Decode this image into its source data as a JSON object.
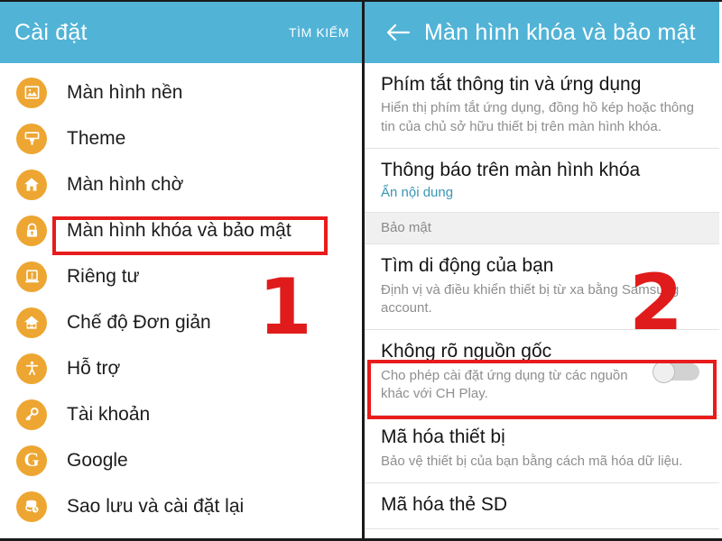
{
  "left_panel": {
    "header": {
      "title": "Cài đặt",
      "action_label": "TÌM KIẾM"
    },
    "items": [
      {
        "label": "Màn hình nền",
        "icon": "image-icon"
      },
      {
        "label": "Theme",
        "icon": "brush-icon"
      },
      {
        "label": "Màn hình chờ",
        "icon": "home-icon"
      },
      {
        "label": "Màn hình khóa và bảo mật",
        "icon": "lock-icon"
      },
      {
        "label": "Riêng tư",
        "icon": "privacy-icon"
      },
      {
        "label": "Chế độ Đơn giản",
        "icon": "simple-mode-icon"
      },
      {
        "label": "Hỗ trợ",
        "icon": "accessibility-icon"
      },
      {
        "label": "Tài khoản",
        "icon": "key-icon"
      },
      {
        "label": "Google",
        "icon": "google-g-icon"
      },
      {
        "label": "Sao lưu và cài đặt lại",
        "icon": "backup-restore-icon"
      }
    ]
  },
  "right_panel": {
    "header": {
      "title": "Màn hình khóa và bảo mật",
      "back_icon": "back-arrow-icon"
    },
    "prefs": [
      {
        "title": "Phím tắt thông tin và ứng dụng",
        "sub": "Hiển thị phím tắt ứng dụng, đồng hồ kép hoặc thông tin của chủ sở hữu thiết bị trên màn hình khóa."
      },
      {
        "title": "Thông báo trên màn hình khóa",
        "sub": "Ẩn nội dung"
      }
    ],
    "section_label": "Bảo mật",
    "prefs2": [
      {
        "title": "Tìm di động của bạn",
        "sub": "Định vị và điều khiển thiết bị từ xa bằng Samsung account."
      },
      {
        "title": "Không rõ nguồn gốc",
        "sub": "Cho phép cài đặt ứng dụng từ các nguồn khác với CH Play.",
        "toggle": "off"
      },
      {
        "title": "Mã hóa thiết bị",
        "sub": "Bảo vệ thiết bị của bạn bằng cách mã hóa dữ liệu."
      },
      {
        "title": "Mã hóa thẻ SD",
        "sub": ""
      }
    ]
  },
  "annotations": {
    "step_one": "1",
    "step_two": "2"
  },
  "colors": {
    "appbar": "#51b3d6",
    "icon_circle": "#eda632",
    "highlight": "#e81c1c",
    "link": "#3b97b5"
  }
}
